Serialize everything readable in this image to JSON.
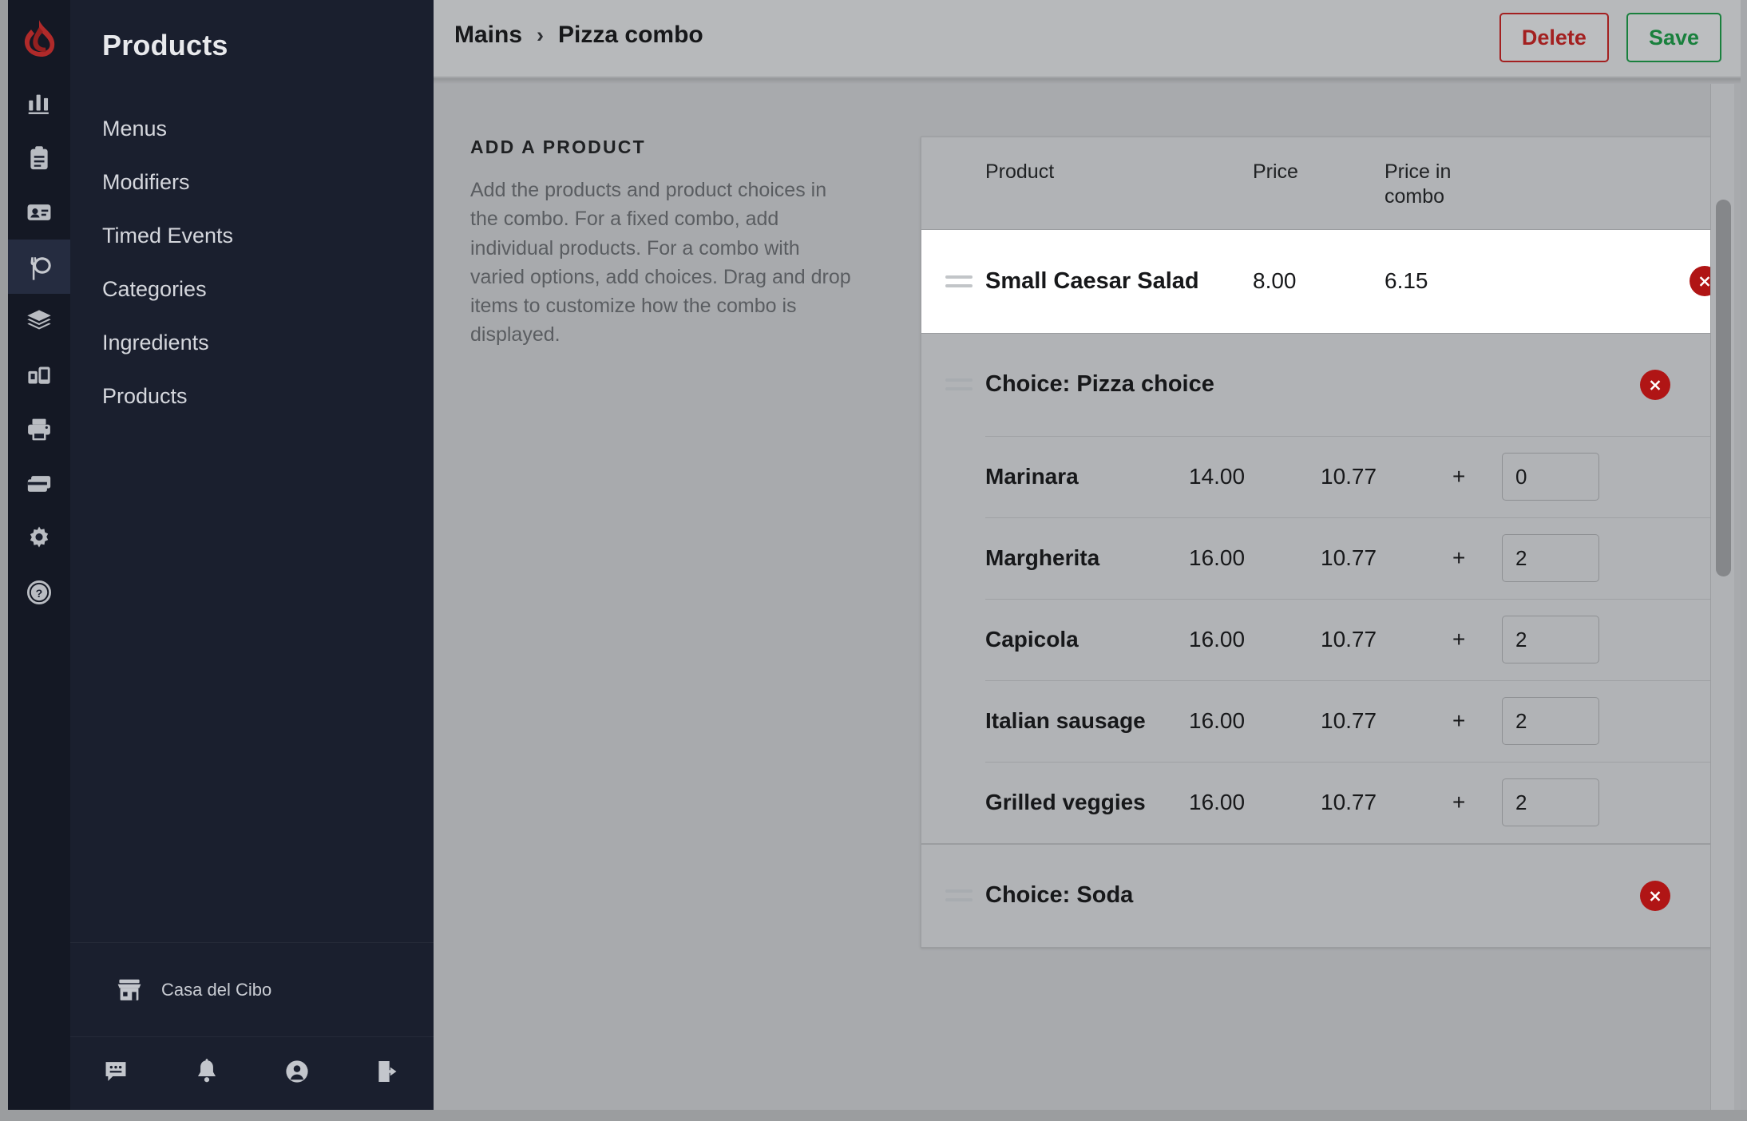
{
  "brand": {
    "logo_name": "lightspeed-logo",
    "logo_color": "#b02a2a"
  },
  "rail": {
    "items": [
      {
        "name": "reports-icon",
        "label": "Reports"
      },
      {
        "name": "clipboard-icon",
        "label": "Orders"
      },
      {
        "name": "id-card-icon",
        "label": "Customers"
      },
      {
        "name": "dining-icon",
        "label": "Products",
        "active": true
      },
      {
        "name": "layers-icon",
        "label": "Inventory"
      },
      {
        "name": "devices-icon",
        "label": "Devices"
      },
      {
        "name": "printer-icon",
        "label": "Printers"
      },
      {
        "name": "payments-icon",
        "label": "Payments"
      },
      {
        "name": "gear-icon",
        "label": "Settings"
      },
      {
        "name": "help-icon",
        "label": "Help"
      }
    ]
  },
  "sidebar": {
    "title": "Products",
    "items": [
      {
        "label": "Menus"
      },
      {
        "label": "Modifiers"
      },
      {
        "label": "Timed Events"
      },
      {
        "label": "Categories"
      },
      {
        "label": "Ingredients"
      },
      {
        "label": "Products"
      }
    ],
    "store": {
      "icon": "store-icon",
      "name": "Casa del Cibo"
    },
    "footer_icons": [
      {
        "name": "chat-icon"
      },
      {
        "name": "bell-icon"
      },
      {
        "name": "account-icon"
      },
      {
        "name": "logout-icon"
      }
    ]
  },
  "topbar": {
    "breadcrumb": {
      "parent": "Mains",
      "separator": "›",
      "current": "Pizza combo"
    },
    "delete_label": "Delete",
    "save_label": "Save",
    "delete_color": "#a32020",
    "save_color": "#19803d"
  },
  "info": {
    "title": "ADD A PRODUCT",
    "body": "Add the products and product choices in the combo. For a fixed combo, add individual products. For a combo with varied options, add choices. Drag and drop items to customize how the combo is displayed."
  },
  "table": {
    "headers": {
      "product": "Product",
      "price": "Price",
      "price_in_combo": "Price in combo"
    },
    "rows": [
      {
        "type": "product",
        "name": "Small Caesar Salad",
        "price": "8.00",
        "price_in_combo": "6.15",
        "highlighted": true
      },
      {
        "type": "choice",
        "title": "Choice: Pizza choice",
        "options": [
          {
            "name": "Marinara",
            "price": "14.00",
            "price_in_combo": "10.77",
            "plus": "+",
            "qty": "0"
          },
          {
            "name": "Margherita",
            "price": "16.00",
            "price_in_combo": "10.77",
            "plus": "+",
            "qty": "2"
          },
          {
            "name": "Capicola",
            "price": "16.00",
            "price_in_combo": "10.77",
            "plus": "+",
            "qty": "2"
          },
          {
            "name": "Italian sausage",
            "price": "16.00",
            "price_in_combo": "10.77",
            "plus": "+",
            "qty": "2"
          },
          {
            "name": "Grilled veggies",
            "price": "16.00",
            "price_in_combo": "10.77",
            "plus": "+",
            "qty": "2"
          }
        ]
      },
      {
        "type": "choice",
        "title": "Choice: Soda",
        "options": []
      }
    ],
    "delete_icon": "delete-circle-icon",
    "drag_icon": "drag-handle-icon"
  },
  "scrollbar": {
    "name": "vertical-scrollbar"
  }
}
